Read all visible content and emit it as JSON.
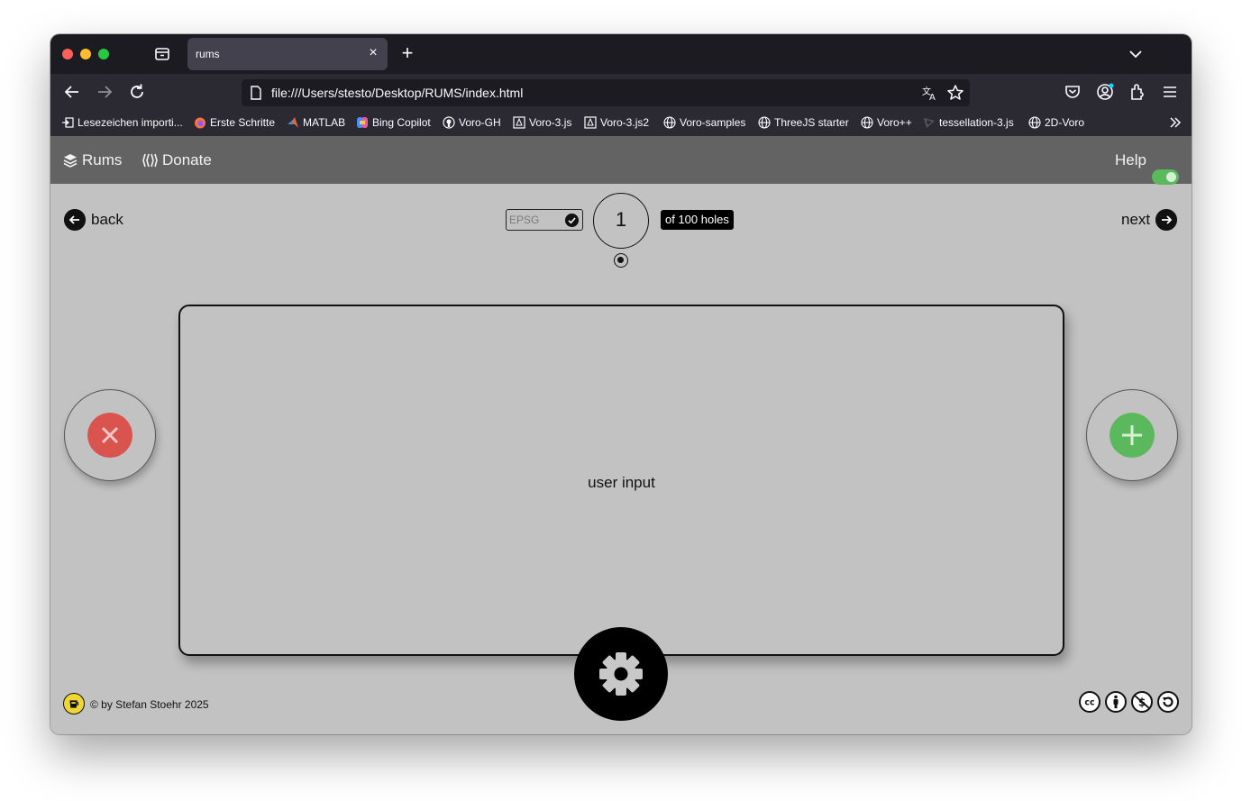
{
  "browser": {
    "tab": {
      "title": "rums",
      "close": "×"
    },
    "new_tab": "+",
    "url": "file:///Users/stesto/Desktop/RUMS/index.html",
    "bookmarks": [
      {
        "label": "Lesezeichen importi...",
        "icon": "import-icon"
      },
      {
        "label": "Erste Schritte",
        "icon": "firefox-icon"
      },
      {
        "label": "MATLAB",
        "icon": "matlab-icon"
      },
      {
        "label": "Bing Copilot",
        "icon": "copilot-icon"
      },
      {
        "label": "Voro-GH",
        "icon": "github-icon"
      },
      {
        "label": "Voro-3.js",
        "icon": "threejs-icon"
      },
      {
        "label": "Voro-3.js2",
        "icon": "threejs-icon"
      },
      {
        "label": "Voro-samples",
        "icon": "globe-icon"
      },
      {
        "label": "ThreeJS starter",
        "icon": "globe-icon"
      },
      {
        "label": "Voro++",
        "icon": "globe-icon"
      },
      {
        "label": "tessellation-3.js",
        "icon": "tessellation-icon"
      },
      {
        "label": "2D-Voro",
        "icon": "globe-icon"
      }
    ]
  },
  "app": {
    "header": {
      "brand": "Rums",
      "donate": "Donate",
      "help": "Help",
      "help_toggle_on": true
    },
    "nav": {
      "back": "back",
      "next": "next"
    },
    "epsg": {
      "placeholder": "EPSG"
    },
    "hole": {
      "current": "1",
      "total_label": "of 100 holes"
    },
    "input_panel": {
      "label": "user input"
    },
    "colors": {
      "reject": "#d9534f",
      "accept": "#5cb85c",
      "background": "#c2c2c2",
      "header": "#636363"
    },
    "footer": {
      "copyright": "© by Stefan Stoehr 2025"
    }
  }
}
